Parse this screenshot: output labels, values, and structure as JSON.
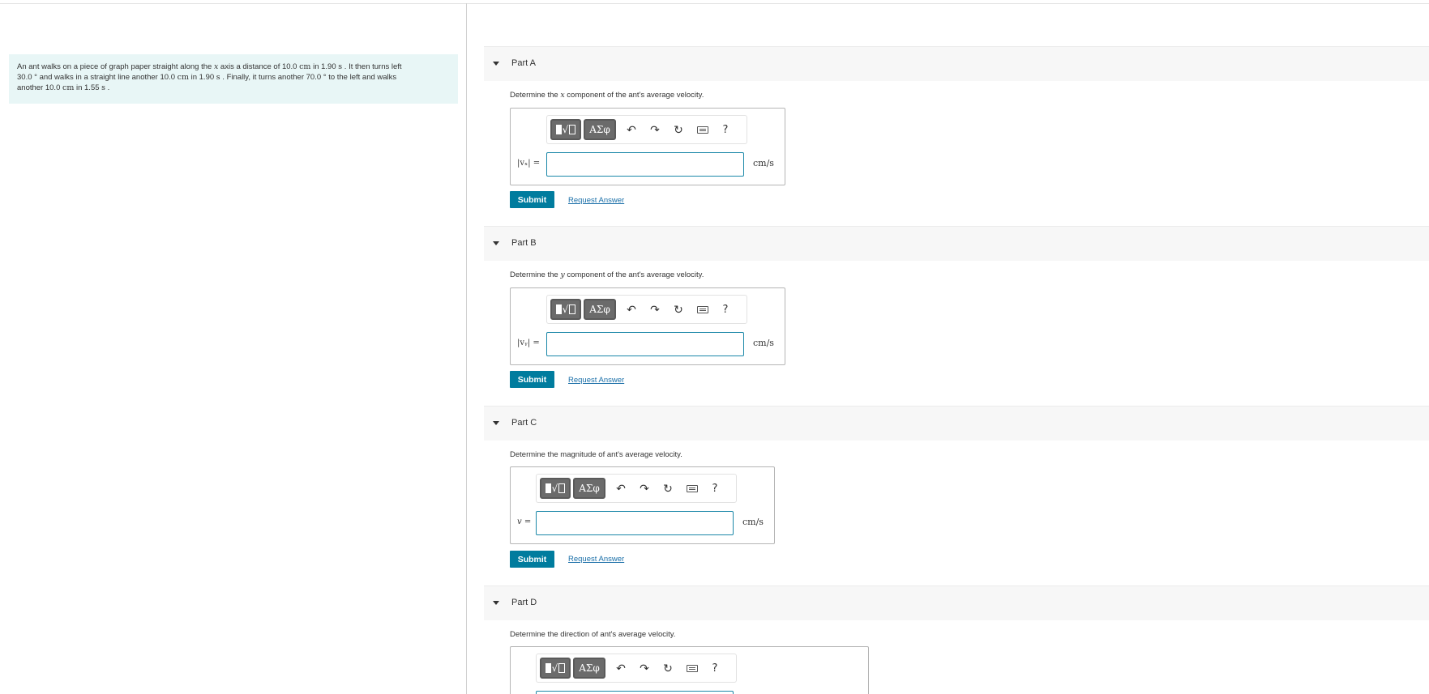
{
  "problem": {
    "line1_a": "An ant walks on a piece of graph paper straight along the ",
    "line1_var": "x",
    "line1_b": " axis a distance of 10.0 ",
    "line1_unit1": "cm",
    "line1_c": " in 1.90 ",
    "line1_unit2": "s",
    "line1_d": " . It then turns left",
    "line2_a": "30.0 ° and walks in a straight line another 10.0 ",
    "line2_unit1": "cm",
    "line2_b": " in 1.90 ",
    "line2_unit2": "s",
    "line2_c": " . Finally, it turns another 70.0 ° to the left and walks",
    "line3_a": "another 10.0 ",
    "line3_unit1": "cm",
    "line3_b": " in 1.55 ",
    "line3_unit2": "s",
    "line3_c": " ."
  },
  "toolbar": {
    "greek_label": "ΑΣφ",
    "templates_rad": "√",
    "undo_symbol": "↶",
    "redo_symbol": "↷",
    "reset_symbol": "↻",
    "help_symbol": "?"
  },
  "parts": [
    {
      "title": "Part A",
      "question_a": "Determine the ",
      "question_var": "x",
      "question_b": " component of the ant's average velocity.",
      "var_label": "|vₓ| =",
      "unit": "cm/s",
      "submit_label": "Submit",
      "request_label": "Request Answer"
    },
    {
      "title": "Part B",
      "question_a": "Determine the ",
      "question_var": "y",
      "question_b": " component of the ant's average velocity.",
      "var_label": "|vᵧ| =",
      "unit": "cm/s",
      "submit_label": "Submit",
      "request_label": "Request Answer"
    },
    {
      "title": "Part C",
      "question_a": "Determine the magnitude of ant's average velocity.",
      "question_var": "",
      "question_b": "",
      "var_label": "v =",
      "unit": "cm/s",
      "submit_label": "Submit",
      "request_label": "Request Answer"
    },
    {
      "title": "Part D",
      "question_a": "Determine the direction of ant's average velocity.",
      "question_var": "",
      "question_b": "",
      "var_label": "",
      "unit": "",
      "submit_label": "",
      "request_label": ""
    }
  ],
  "colors": {
    "accent": "#007c9e",
    "problem_bg": "#e8f6f6",
    "input_border": "#1a87a8",
    "link": "#1a6fa8"
  }
}
